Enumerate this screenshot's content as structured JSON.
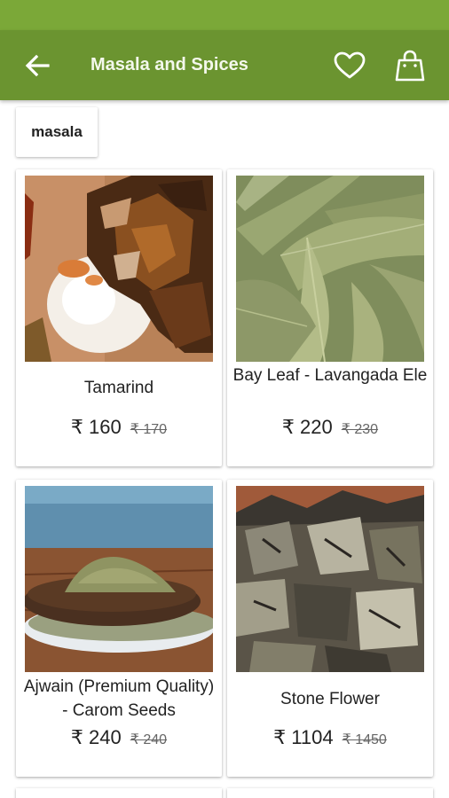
{
  "header": {
    "title": "Masala and Spices",
    "back_icon": "arrow-back-icon",
    "fav_icon": "heart-icon",
    "cart_icon": "shopping-bag-icon",
    "color_primary": "#6b9430",
    "color_status": "#7ba838"
  },
  "filter_chip": {
    "label": "masala"
  },
  "products": [
    {
      "name": "Tamarind",
      "price": "₹ 160",
      "mrp": "₹ 170"
    },
    {
      "name": "Bay Leaf - Lavangada Ele",
      "price": "₹ 220",
      "mrp": "₹ 230"
    },
    {
      "name": "Ajwain (Premium Quality) - Carom Seeds",
      "price": "₹ 240",
      "mrp": "₹ 240"
    },
    {
      "name": "Stone Flower",
      "price": "₹ 1104",
      "mrp": "₹ 1450"
    }
  ]
}
